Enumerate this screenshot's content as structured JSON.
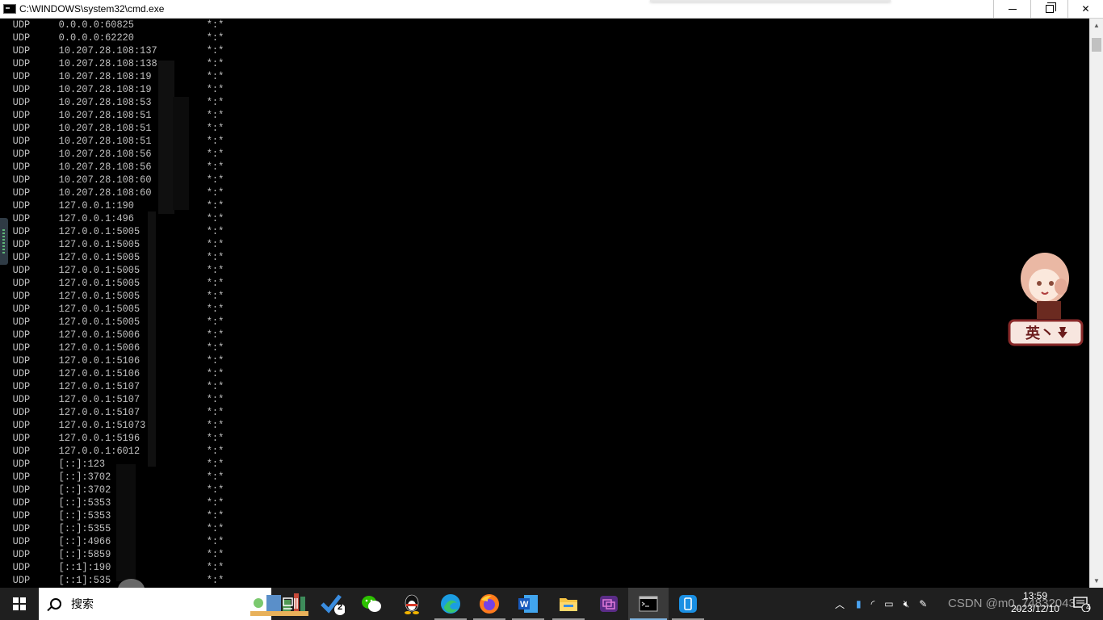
{
  "window": {
    "title": "C:\\WINDOWS\\system32\\cmd.exe",
    "minimize": "–",
    "close": "✕"
  },
  "console": {
    "lines": [
      {
        "proto": "UDP",
        "addr": "0.0.0.0:60825",
        "foreign": "*:*"
      },
      {
        "proto": "UDP",
        "addr": "0.0.0.0:62220",
        "foreign": "*:*"
      },
      {
        "proto": "UDP",
        "addr": "10.207.28.108:137",
        "foreign": "*:*"
      },
      {
        "proto": "UDP",
        "addr": "10.207.28.108:138",
        "foreign": "*:*"
      },
      {
        "proto": "UDP",
        "addr": "10.207.28.108:19",
        "foreign": "*:*"
      },
      {
        "proto": "UDP",
        "addr": "10.207.28.108:19",
        "foreign": "*:*"
      },
      {
        "proto": "UDP",
        "addr": "10.207.28.108:53",
        "foreign": "*:*"
      },
      {
        "proto": "UDP",
        "addr": "10.207.28.108:51",
        "foreign": "*:*"
      },
      {
        "proto": "UDP",
        "addr": "10.207.28.108:51",
        "foreign": "*:*"
      },
      {
        "proto": "UDP",
        "addr": "10.207.28.108:51",
        "foreign": "*:*"
      },
      {
        "proto": "UDP",
        "addr": "10.207.28.108:56",
        "foreign": "*:*"
      },
      {
        "proto": "UDP",
        "addr": "10.207.28.108:56",
        "foreign": "*:*"
      },
      {
        "proto": "UDP",
        "addr": "10.207.28.108:60",
        "foreign": "*:*"
      },
      {
        "proto": "UDP",
        "addr": "10.207.28.108:60",
        "foreign": "*:*"
      },
      {
        "proto": "UDP",
        "addr": "127.0.0.1:190",
        "foreign": "*:*"
      },
      {
        "proto": "UDP",
        "addr": "127.0.0.1:496",
        "foreign": "*:*"
      },
      {
        "proto": "UDP",
        "addr": "127.0.0.1:5005",
        "foreign": "*:*"
      },
      {
        "proto": "UDP",
        "addr": "127.0.0.1:5005",
        "foreign": "*:*"
      },
      {
        "proto": "UDP",
        "addr": "127.0.0.1:5005",
        "foreign": "*:*"
      },
      {
        "proto": "UDP",
        "addr": "127.0.0.1:5005",
        "foreign": "*:*"
      },
      {
        "proto": "UDP",
        "addr": "127.0.0.1:5005",
        "foreign": "*:*"
      },
      {
        "proto": "UDP",
        "addr": "127.0.0.1:5005",
        "foreign": "*:*"
      },
      {
        "proto": "UDP",
        "addr": "127.0.0.1:5005",
        "foreign": "*:*"
      },
      {
        "proto": "UDP",
        "addr": "127.0.0.1:5005",
        "foreign": "*:*"
      },
      {
        "proto": "UDP",
        "addr": "127.0.0.1:5006",
        "foreign": "*:*"
      },
      {
        "proto": "UDP",
        "addr": "127.0.0.1:5006",
        "foreign": "*:*"
      },
      {
        "proto": "UDP",
        "addr": "127.0.0.1:5106",
        "foreign": "*:*"
      },
      {
        "proto": "UDP",
        "addr": "127.0.0.1:5106",
        "foreign": "*:*"
      },
      {
        "proto": "UDP",
        "addr": "127.0.0.1:5107",
        "foreign": "*:*"
      },
      {
        "proto": "UDP",
        "addr": "127.0.0.1:5107",
        "foreign": "*:*"
      },
      {
        "proto": "UDP",
        "addr": "127.0.0.1:5107",
        "foreign": "*:*"
      },
      {
        "proto": "UDP",
        "addr": "127.0.0.1:51073",
        "foreign": "*:*"
      },
      {
        "proto": "UDP",
        "addr": "127.0.0.1:5196",
        "foreign": "*:*"
      },
      {
        "proto": "UDP",
        "addr": "127.0.0.1:6012",
        "foreign": "*:*"
      },
      {
        "proto": "UDP",
        "addr": "[::]:123",
        "foreign": "*:*"
      },
      {
        "proto": "UDP",
        "addr": "[::]:3702",
        "foreign": "*:*"
      },
      {
        "proto": "UDP",
        "addr": "[::]:3702",
        "foreign": "*:*"
      },
      {
        "proto": "UDP",
        "addr": "[::]:5353",
        "foreign": "*:*"
      },
      {
        "proto": "UDP",
        "addr": "[::]:5353",
        "foreign": "*:*"
      },
      {
        "proto": "UDP",
        "addr": "[::]:5355",
        "foreign": "*:*"
      },
      {
        "proto": "UDP",
        "addr": "[::]:4966",
        "foreign": "*:*"
      },
      {
        "proto": "UDP",
        "addr": "[::]:5859",
        "foreign": "*:*"
      },
      {
        "proto": "UDP",
        "addr": "[::1]:190",
        "foreign": "*:*"
      },
      {
        "proto": "UDP",
        "addr": "[::1]:535",
        "foreign": "*:*"
      }
    ]
  },
  "taskbar": {
    "search_placeholder": "搜索",
    "todo_badge": "2",
    "clock_time": "13:59",
    "clock_date": "2023/12/10",
    "notification_badge": "4",
    "watermark": "CSDN @m0_74832043"
  },
  "mascot": {
    "caption": "英丶"
  },
  "colors": {
    "console_bg": "#000000",
    "console_text": "#c0c0c0",
    "taskbar_bg": "#1f1f1f"
  }
}
